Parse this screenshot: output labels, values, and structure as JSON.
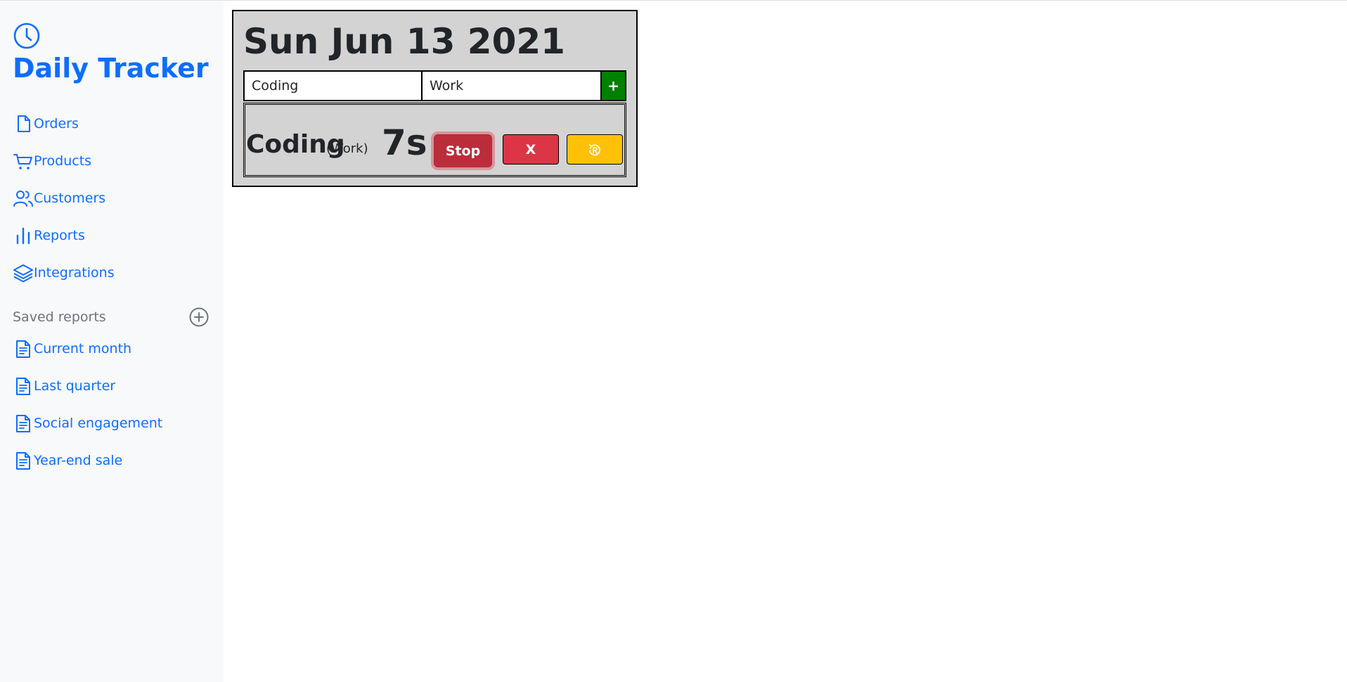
{
  "app": {
    "title": "Daily Tracker",
    "brand_icon": "clock-icon",
    "accent_color": "#0d6efd"
  },
  "nav": [
    {
      "label": "Orders",
      "icon": "file-icon"
    },
    {
      "label": "Products",
      "icon": "cart-icon"
    },
    {
      "label": "Customers",
      "icon": "users-icon"
    },
    {
      "label": "Reports",
      "icon": "bar-chart-icon"
    },
    {
      "label": "Integrations",
      "icon": "layers-icon"
    }
  ],
  "saved_reports": {
    "heading": "Saved reports",
    "add_icon": "plus-circle-icon",
    "items": [
      {
        "label": "Current month",
        "icon": "file-text-icon"
      },
      {
        "label": "Last quarter",
        "icon": "file-text-icon"
      },
      {
        "label": "Social engagement",
        "icon": "file-text-icon"
      },
      {
        "label": "Year-end sale",
        "icon": "file-text-icon"
      }
    ]
  },
  "tracker": {
    "date": "Sun Jun 13 2021",
    "task_input_value": "Coding",
    "category_input_value": "Work",
    "add_label": "+",
    "entry": {
      "name": "Coding",
      "category": "(Work)",
      "elapsed": "7s",
      "stop_label": "Stop",
      "delete_label": "X",
      "reset_icon": "reset-icon"
    }
  }
}
